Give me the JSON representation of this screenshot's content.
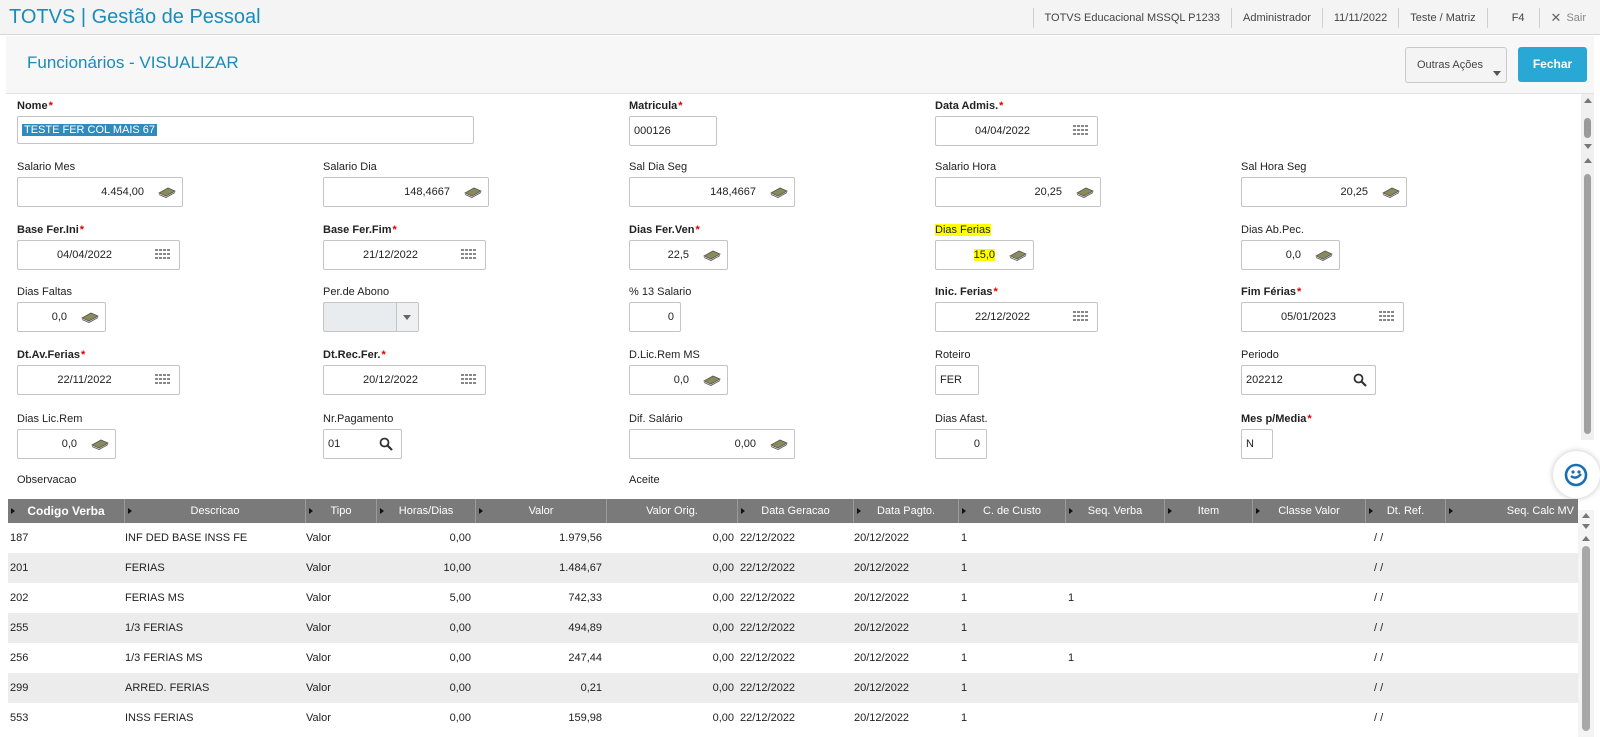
{
  "app": {
    "title": "TOTVS | Gestão de Pessoal"
  },
  "topbar": {
    "environment": "TOTVS Educacional MSSQL P1233",
    "user": "Administrador",
    "date": "11/11/2022",
    "branch": "Teste / Matriz",
    "shortcut": "F4",
    "exit_label": "Sair"
  },
  "header": {
    "title": "Funcionários - VISUALIZAR",
    "other_actions": "Outras Ações",
    "close": "Fechar"
  },
  "colors": {
    "accent": "#1a8cba",
    "button": "#2aa8d5",
    "highlight": "#ffff00",
    "required": "#dd0000"
  },
  "fields": {
    "nome": {
      "label": "Nome",
      "value": "TESTE FER COL MAIS 67"
    },
    "matricula": {
      "label": "Matricula",
      "value": "000126"
    },
    "data_admis": {
      "label": "Data Admis.",
      "value": "04/04/2022"
    },
    "salario_mes": {
      "label": "Salario Mes",
      "value": "4.454,00"
    },
    "salario_dia": {
      "label": "Salario Dia",
      "value": "148,4667"
    },
    "sal_dia_seg": {
      "label": "Sal Dia Seg",
      "value": "148,4667"
    },
    "salario_hora": {
      "label": "Salario Hora",
      "value": "20,25"
    },
    "sal_hora_seg": {
      "label": "Sal Hora Seg",
      "value": "20,25"
    },
    "base_fer_ini": {
      "label": "Base Fer.Ini",
      "value": "04/04/2022"
    },
    "base_fer_fim": {
      "label": "Base Fer.Fim",
      "value": "21/12/2022"
    },
    "dias_fer_ven": {
      "label": "Dias Fer.Ven",
      "value": "22,5"
    },
    "dias_ferias": {
      "label": "Dias Ferias",
      "value": "15,0"
    },
    "dias_ab_pec": {
      "label": "Dias Ab.Pec.",
      "value": "0,0"
    },
    "dias_faltas": {
      "label": "Dias Faltas",
      "value": "0,0"
    },
    "per_abono": {
      "label": "Per.de Abono",
      "value": ""
    },
    "pct_13_salario": {
      "label": "% 13 Salario",
      "value": "0"
    },
    "inic_ferias": {
      "label": "Inic. Ferias",
      "value": "22/12/2022"
    },
    "fim_ferias": {
      "label": "Fim Férias",
      "value": "05/01/2023"
    },
    "dt_av_ferias": {
      "label": "Dt.Av.Ferias",
      "value": "22/11/2022"
    },
    "dt_rec_fer": {
      "label": "Dt.Rec.Fer.",
      "value": "20/12/2022"
    },
    "d_lic_rem_ms": {
      "label": "D.Lic.Rem MS",
      "value": "0,0"
    },
    "roteiro": {
      "label": "Roteiro",
      "value": "FER"
    },
    "periodo": {
      "label": "Periodo",
      "value": "202212"
    },
    "dias_lic_rem": {
      "label": "Dias Lic.Rem",
      "value": "0,0"
    },
    "nr_pagamento": {
      "label": "Nr.Pagamento",
      "value": "01"
    },
    "dif_salario": {
      "label": "Dif. Salário",
      "value": "0,00"
    },
    "dias_afast": {
      "label": "Dias Afast.",
      "value": "0"
    },
    "mes_p_media": {
      "label": "Mes p/Media",
      "value": "N"
    },
    "observacao": {
      "label": "Observacao"
    },
    "aceite": {
      "label": "Aceite"
    }
  },
  "grid": {
    "columns": [
      "Codigo Verba",
      "Descricao",
      "Tipo",
      "Horas/Dias",
      "Valor",
      "Valor Orig.",
      "Data Geracao",
      "Data Pagto.",
      "C. de Custo",
      "Seq. Verba",
      "Item",
      "Classe Valor",
      "Dt. Ref.",
      "Seq. Calc MV"
    ],
    "rows": [
      {
        "codigo": "187",
        "descricao": "INF DED BASE INSS FE",
        "tipo": "Valor",
        "horas": "0,00",
        "valor": "1.979,56",
        "valor_orig": "0,00",
        "data_geracao": "22/12/2022",
        "data_pagto": "20/12/2022",
        "c_custo": "1",
        "seq_verba": "",
        "dt_ref": "/  /"
      },
      {
        "codigo": "201",
        "descricao": "FERIAS",
        "tipo": "Valor",
        "horas": "10,00",
        "valor": "1.484,67",
        "valor_orig": "0,00",
        "data_geracao": "22/12/2022",
        "data_pagto": "20/12/2022",
        "c_custo": "1",
        "seq_verba": "",
        "dt_ref": "/  /"
      },
      {
        "codigo": "202",
        "descricao": "FERIAS MS",
        "tipo": "Valor",
        "horas": "5,00",
        "valor": "742,33",
        "valor_orig": "0,00",
        "data_geracao": "22/12/2022",
        "data_pagto": "20/12/2022",
        "c_custo": "1",
        "seq_verba": "1",
        "dt_ref": "/  /"
      },
      {
        "codigo": "255",
        "descricao": "1/3 FERIAS",
        "tipo": "Valor",
        "horas": "0,00",
        "valor": "494,89",
        "valor_orig": "0,00",
        "data_geracao": "22/12/2022",
        "data_pagto": "20/12/2022",
        "c_custo": "1",
        "seq_verba": "",
        "dt_ref": "/  /"
      },
      {
        "codigo": "256",
        "descricao": "1/3 FERIAS MS",
        "tipo": "Valor",
        "horas": "0,00",
        "valor": "247,44",
        "valor_orig": "0,00",
        "data_geracao": "22/12/2022",
        "data_pagto": "20/12/2022",
        "c_custo": "1",
        "seq_verba": "1",
        "dt_ref": "/  /"
      },
      {
        "codigo": "299",
        "descricao": "ARRED. FERIAS",
        "tipo": "Valor",
        "horas": "0,00",
        "valor": "0,21",
        "valor_orig": "0,00",
        "data_geracao": "22/12/2022",
        "data_pagto": "20/12/2022",
        "c_custo": "1",
        "seq_verba": "",
        "dt_ref": "/  /"
      },
      {
        "codigo": "553",
        "descricao": "INSS FERIAS",
        "tipo": "Valor",
        "horas": "0,00",
        "valor": "159,98",
        "valor_orig": "0,00",
        "data_geracao": "22/12/2022",
        "data_pagto": "20/12/2022",
        "c_custo": "1",
        "seq_verba": "",
        "dt_ref": "/  /"
      }
    ]
  }
}
